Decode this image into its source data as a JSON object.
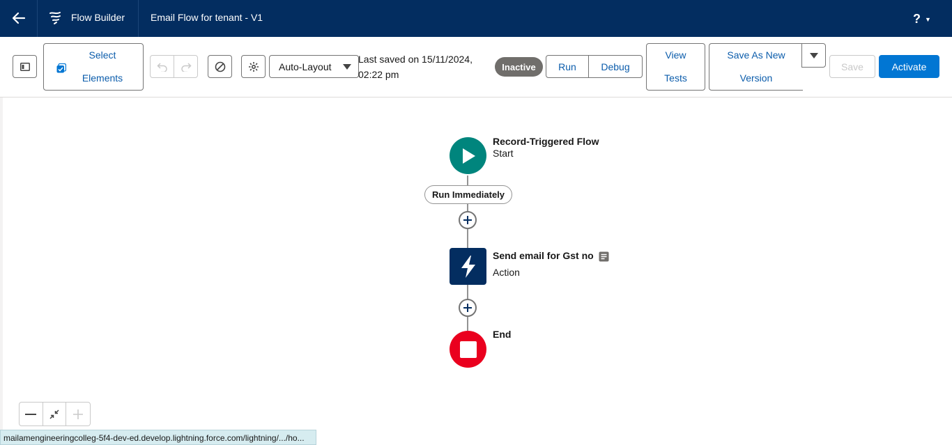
{
  "header": {
    "app_label": "Flow Builder",
    "flow_name": "Email Flow for tenant - V1",
    "help_label": "?",
    "icons": {
      "back": "arrow-left-icon",
      "app": "flow-builder-icon",
      "help": "help-icon",
      "caret": "chevron-down-icon"
    }
  },
  "toolbar": {
    "select_elements_line1": "Select",
    "select_elements_line2": "Elements",
    "layout_select_value": "Auto-Layout",
    "last_saved_line1": "Last saved on 15/11/2024,",
    "last_saved_line2": "02:22 pm",
    "status_badge": "Inactive",
    "run_label": "Run",
    "debug_label": "Debug",
    "view_tests_line1": "View",
    "view_tests_line2": "Tests",
    "save_as_new_line1": "Save As New",
    "save_as_new_line2": "Version",
    "save_label": "Save",
    "activate_label": "Activate",
    "colors": {
      "primary": "#0176d3",
      "link": "#0b5cab",
      "badge": "#706e6b"
    }
  },
  "canvas": {
    "start": {
      "title": "Record-Triggered Flow",
      "subtitle": "Start",
      "color": "#00857d"
    },
    "trigger_pill": "Run Immediately",
    "action": {
      "title": "Send email for Gst no",
      "subtitle": "Action",
      "color": "#032d60"
    },
    "end": {
      "title": "End",
      "color": "#ea001e"
    }
  },
  "status_url": "mailamengineeringcolleg-5f4-dev-ed.develop.lightning.force.com/lightning/.../ho..."
}
